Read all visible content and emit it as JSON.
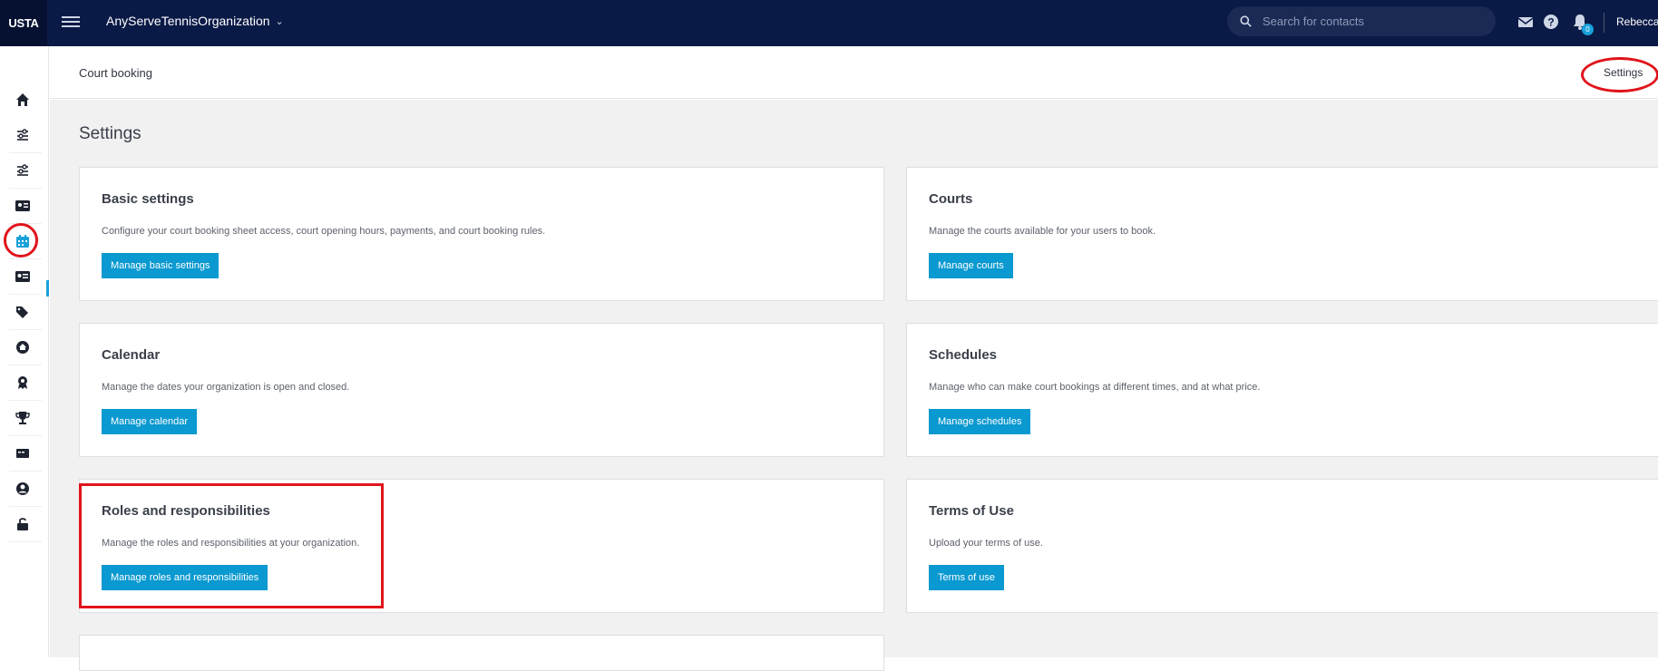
{
  "topbar": {
    "logo": "USTA",
    "org_name": "AnyServeTennisOrganization",
    "search_placeholder": "Search for contacts",
    "notification_count": "0",
    "user_name": "Rebecca V"
  },
  "sidebar": {
    "items": [
      {
        "name": "home-icon"
      },
      {
        "name": "sliders-icon"
      },
      {
        "name": "sliders-icon"
      },
      {
        "name": "id-card-icon"
      },
      {
        "name": "calendar-icon",
        "active": true
      },
      {
        "name": "contact-card-icon"
      },
      {
        "name": "tags-icon"
      },
      {
        "name": "venue-icon"
      },
      {
        "name": "award-icon"
      },
      {
        "name": "trophy-icon"
      },
      {
        "name": "ticket-icon"
      },
      {
        "name": "user-circle-icon"
      },
      {
        "name": "unlock-icon"
      }
    ]
  },
  "subheader": {
    "breadcrumb": "Court booking",
    "settings_link": "Settings"
  },
  "main": {
    "title": "Settings",
    "cards": [
      {
        "title": "Basic settings",
        "description": "Configure your court booking sheet access, court opening hours, payments, and court booking rules.",
        "button": "Manage basic settings"
      },
      {
        "title": "Courts",
        "description": "Manage the courts available for your users to book.",
        "button": "Manage courts"
      },
      {
        "title": "Calendar",
        "description": "Manage the dates your organization is open and closed.",
        "button": "Manage calendar"
      },
      {
        "title": "Schedules",
        "description": "Manage who can make court bookings at different times, and at what price.",
        "button": "Manage schedules"
      },
      {
        "title": "Roles and responsibilities",
        "description": "Manage the roles and responsibilities at your organization.",
        "button": "Manage roles and responsibilities"
      },
      {
        "title": "Terms of Use",
        "description": "Upload your terms of use.",
        "button": "Terms of use"
      }
    ]
  },
  "colors": {
    "topbar": "#0a1a46",
    "accent": "#0a99d0",
    "annotation": "#e0141b"
  }
}
